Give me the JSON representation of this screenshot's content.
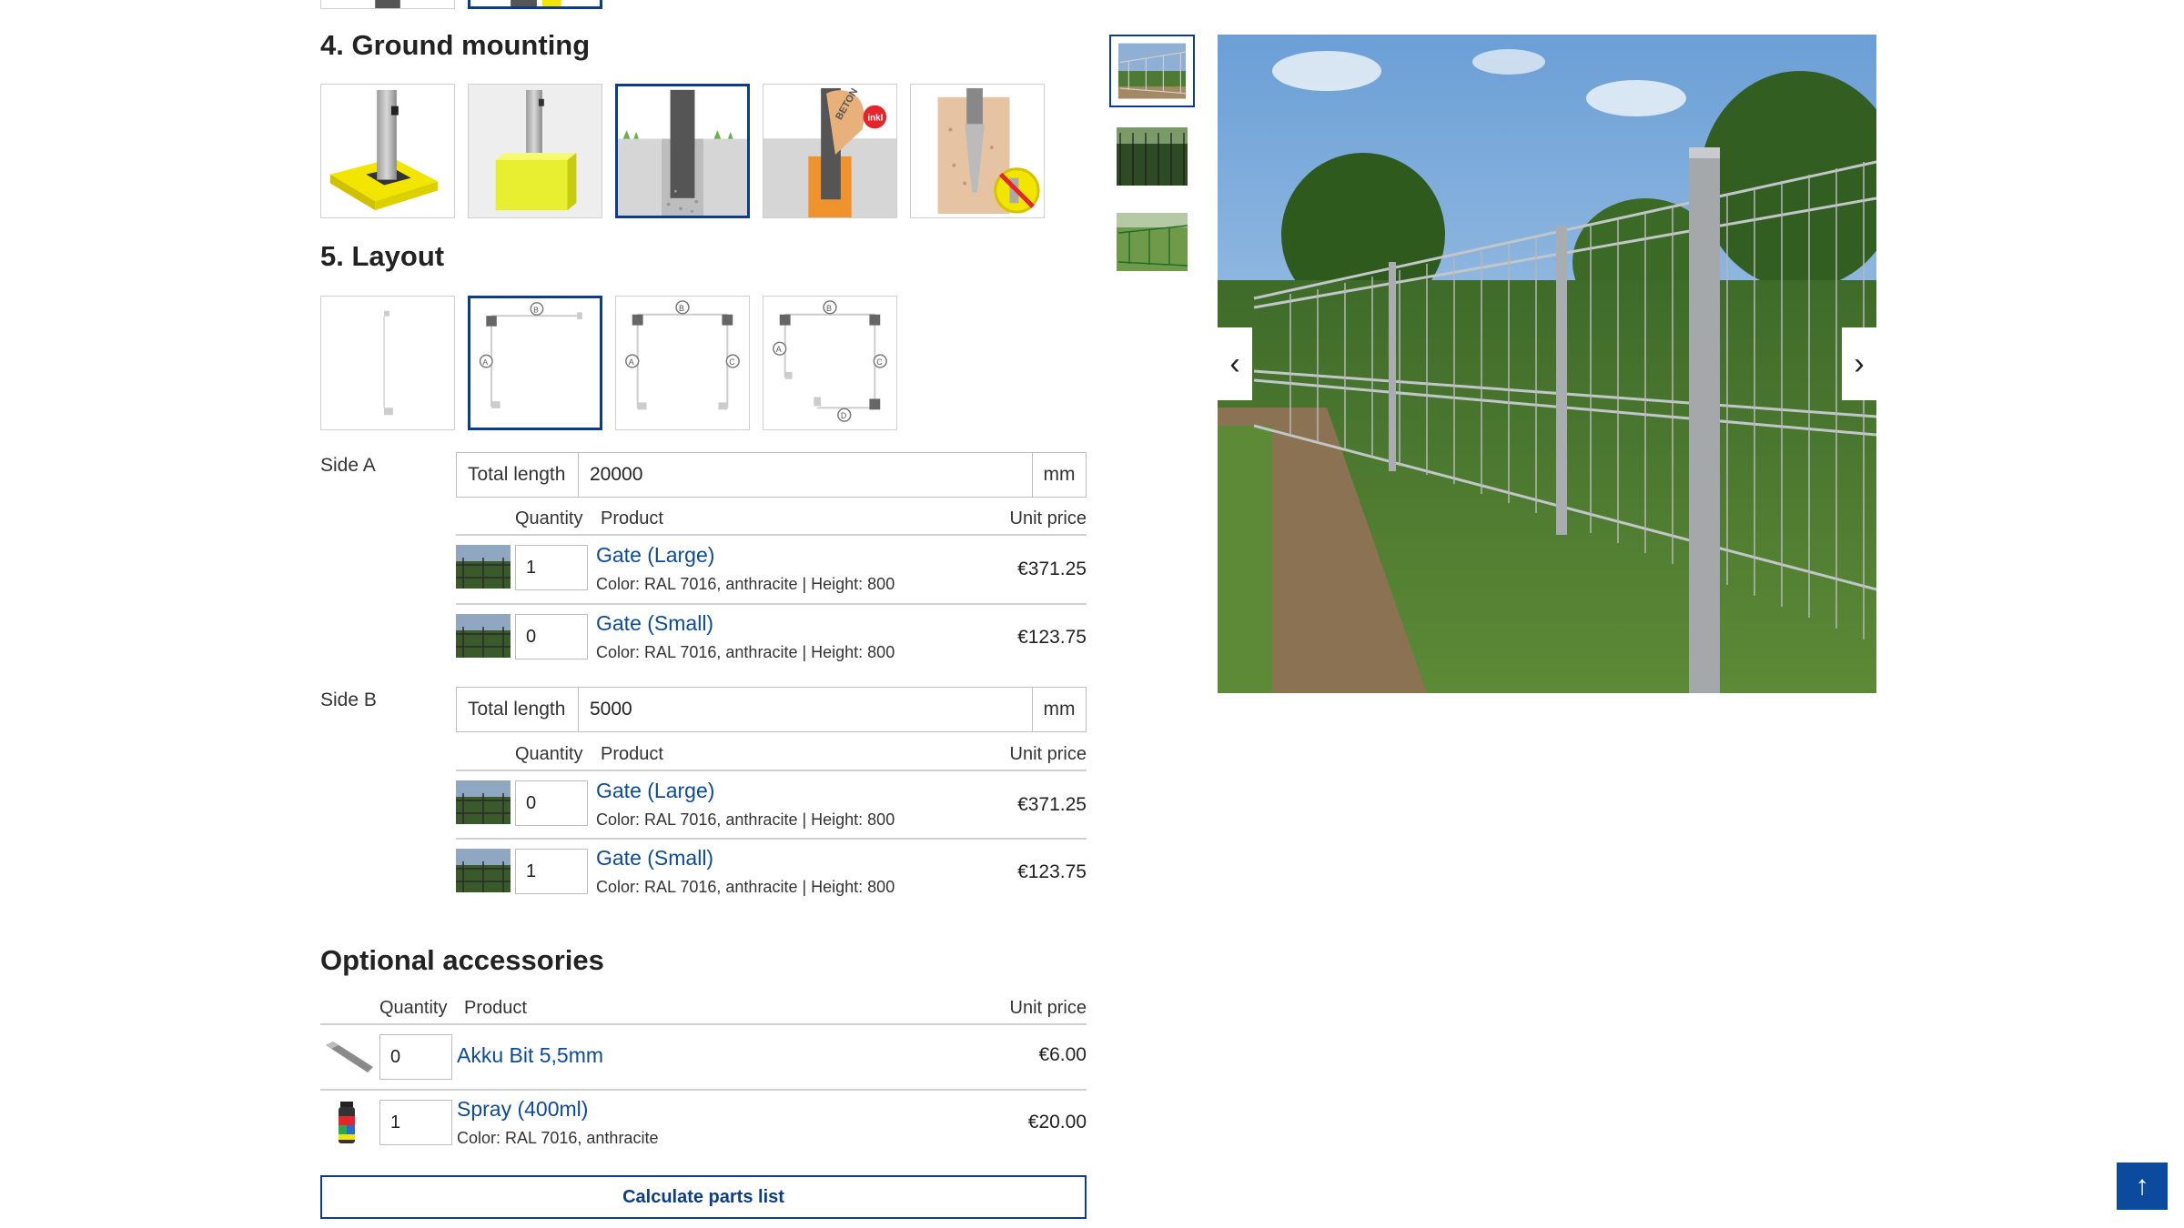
{
  "ground_mounting": {
    "title": "4. Ground mounting",
    "badge": "inkl",
    "beton_text": "BETON",
    "selected_index": 2
  },
  "layout": {
    "title": "5. Layout",
    "selected_index": 1,
    "point_labels": {
      "a": "A",
      "b": "B",
      "c": "C",
      "d": "D"
    }
  },
  "sides": [
    {
      "label": "Side A",
      "total_length_label": "Total length",
      "total_length": "20000",
      "unit": "mm",
      "headers": {
        "quantity": "Quantity",
        "product": "Product",
        "unit_price": "Unit price"
      },
      "items": [
        {
          "qty": "1",
          "name": "Gate (Large)",
          "desc": "Color: RAL 7016, anthracite | Height: 800",
          "price": "€371.25"
        },
        {
          "qty": "0",
          "name": "Gate (Small)",
          "desc": "Color: RAL 7016, anthracite | Height: 800",
          "price": "€123.75"
        }
      ]
    },
    {
      "label": "Side B",
      "total_length_label": "Total length",
      "total_length": "5000",
      "unit": "mm",
      "headers": {
        "quantity": "Quantity",
        "product": "Product",
        "unit_price": "Unit price"
      },
      "items": [
        {
          "qty": "0",
          "name": "Gate (Large)",
          "desc": "Color: RAL 7016, anthracite | Height: 800",
          "price": "€371.25"
        },
        {
          "qty": "1",
          "name": "Gate (Small)",
          "desc": "Color: RAL 7016, anthracite | Height: 800",
          "price": "€123.75"
        }
      ]
    }
  ],
  "accessories": {
    "title": "Optional accessories",
    "headers": {
      "quantity": "Quantity",
      "product": "Product",
      "unit_price": "Unit price"
    },
    "items": [
      {
        "qty": "0",
        "name": "Akku Bit 5,5mm",
        "desc": "",
        "price": "€6.00"
      },
      {
        "qty": "1",
        "name": "Spray (400ml)",
        "desc": "Color: RAL 7016, anthracite",
        "price": "€20.00"
      }
    ]
  },
  "calculate_button": "Calculate parts list",
  "gallery": {
    "prev_icon": "chevron-left-icon",
    "next_icon": "chevron-right-icon",
    "active_thumb": 0
  },
  "scroll_top_icon": "arrow-up-icon",
  "colors": {
    "accent": "#0b3d8c",
    "link": "#0b4a9c",
    "border": "#cfcfcf",
    "yellow": "#f2e600"
  }
}
